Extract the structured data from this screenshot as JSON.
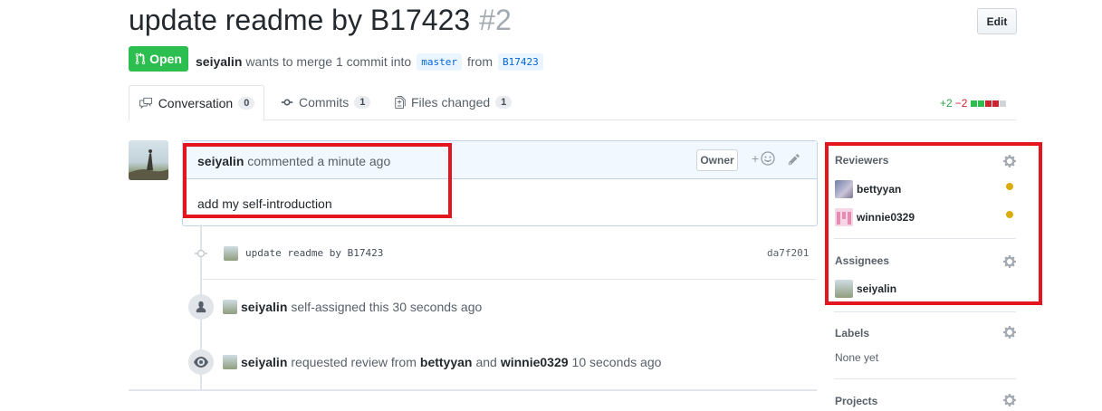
{
  "header": {
    "title": "update readme by B17423",
    "number": "#2",
    "edit_label": "Edit"
  },
  "status": {
    "state_label": "Open",
    "author": "seiyalin",
    "merge_text": "wants to merge 1 commit into",
    "base_branch": "master",
    "from_text": "from",
    "head_branch": "B17423"
  },
  "tabs": [
    {
      "label": "Conversation",
      "count": "0"
    },
    {
      "label": "Commits",
      "count": "1"
    },
    {
      "label": "Files changed",
      "count": "1"
    }
  ],
  "diffstat": {
    "additions": "+2",
    "deletions": "−2"
  },
  "comment": {
    "author": "seiyalin",
    "action": "commented",
    "time": "a minute ago",
    "role_badge": "Owner",
    "reaction_plus": "+",
    "body": "add my self-introduction"
  },
  "commit": {
    "message": "update readme by B17423",
    "sha": "da7f201"
  },
  "events": [
    {
      "actor": "seiyalin",
      "text": "self-assigned this 30 seconds ago"
    },
    {
      "actor": "seiyalin",
      "text_before": "requested review from",
      "reviewer1": "bettyyan",
      "and": "and",
      "reviewer2": "winnie0329",
      "time": "10 seconds ago"
    }
  ],
  "sidebar": {
    "reviewers_title": "Reviewers",
    "reviewers": [
      {
        "name": "bettyyan"
      },
      {
        "name": "winnie0329"
      }
    ],
    "assignees_title": "Assignees",
    "assignees": [
      {
        "name": "seiyalin"
      }
    ],
    "labels_title": "Labels",
    "labels_value": "None yet",
    "projects_title": "Projects"
  },
  "colors": {
    "open_green": "#2cbe4e",
    "highlight_red": "#e3161f",
    "pending_yellow": "#dbab09",
    "additions_green": "#28a745",
    "deletions_red": "#cb2431"
  }
}
